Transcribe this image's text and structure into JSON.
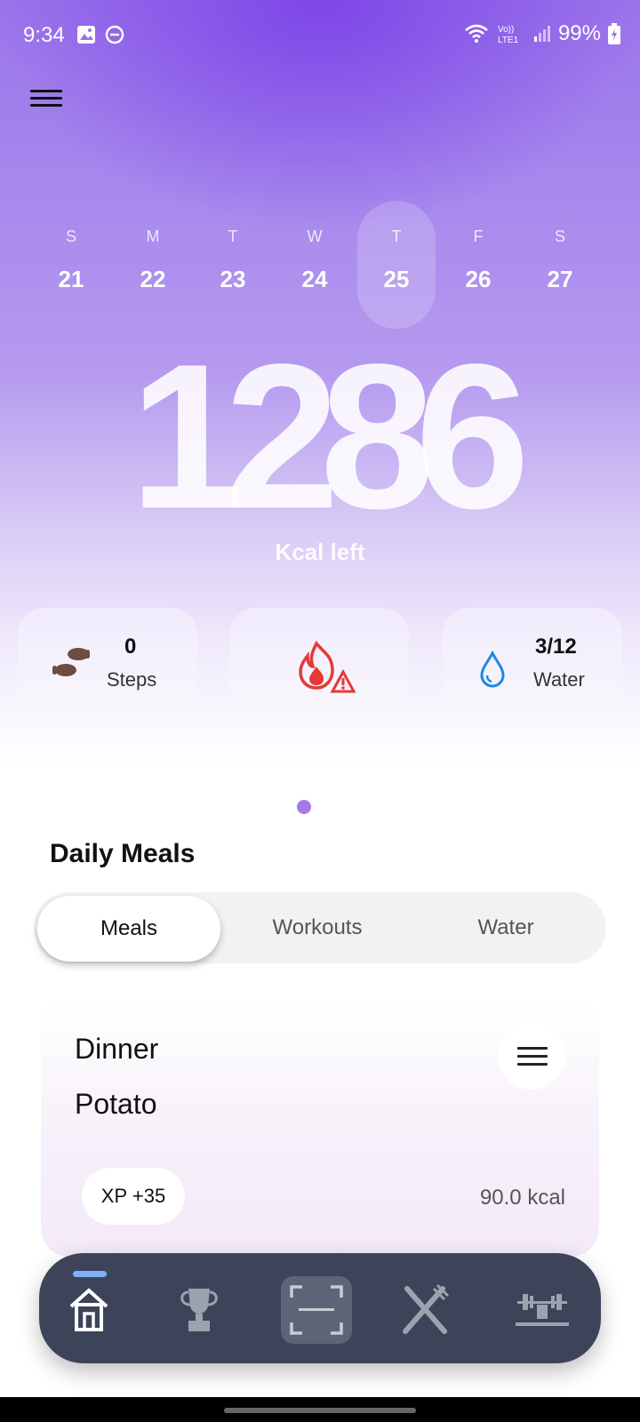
{
  "status_bar": {
    "time": "9:34",
    "battery": "99%",
    "network": "LTE1",
    "volte": "Vo))",
    "wifi_gen": "6"
  },
  "header": {
    "menu_icon": "hamburger-menu-icon"
  },
  "week": {
    "days": [
      {
        "letter": "S",
        "num": "21"
      },
      {
        "letter": "M",
        "num": "22"
      },
      {
        "letter": "T",
        "num": "23"
      },
      {
        "letter": "W",
        "num": "24"
      },
      {
        "letter": "T",
        "num": "25"
      },
      {
        "letter": "F",
        "num": "26"
      },
      {
        "letter": "S",
        "num": "27"
      }
    ],
    "selected_index": 4
  },
  "calories": {
    "value": "1286",
    "label": "Kcal left"
  },
  "stats": {
    "steps": {
      "value": "0",
      "label": "Steps",
      "icon": "footprints-icon"
    },
    "burn": {
      "icon": "flame-warning-icon"
    },
    "water": {
      "value": "3/12",
      "label": "Water",
      "icon": "water-drop-icon"
    }
  },
  "section": {
    "title": "Daily Meals"
  },
  "segments": {
    "tabs": [
      "Meals",
      "Workouts",
      "Water"
    ],
    "active": "Meals"
  },
  "meal_card": {
    "type": "Dinner",
    "name": "Potato",
    "xp": "XP +35",
    "kcal": "90.0 kcal"
  },
  "bottom_nav": {
    "items": [
      "home-icon",
      "trophy-icon",
      "scan-icon",
      "fork-knife-icon",
      "barbell-icon"
    ],
    "active": "home-icon"
  },
  "colors": {
    "accent": "#a57ae8",
    "nav_bg": "#3d4459",
    "flame": "#e53935",
    "water": "#1e88e5",
    "footprint": "#6d4c41"
  }
}
